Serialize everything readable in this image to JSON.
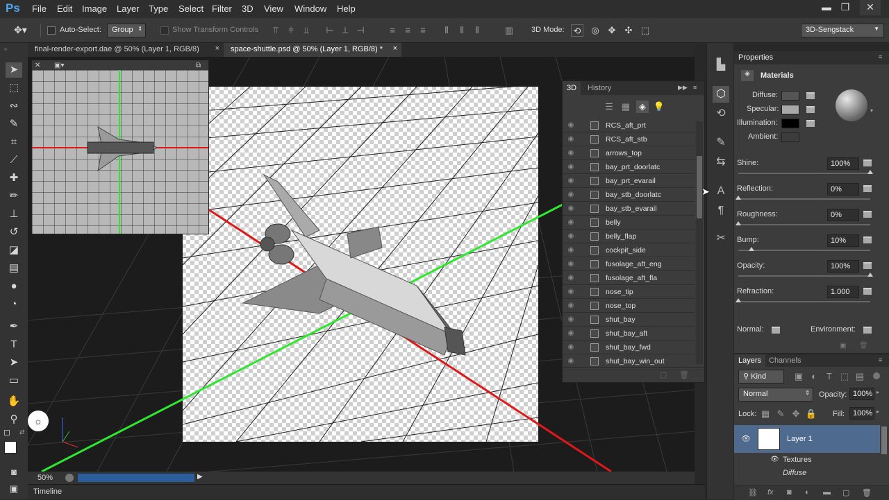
{
  "app": {
    "logo": "Ps"
  },
  "menu": [
    "File",
    "Edit",
    "Image",
    "Layer",
    "Type",
    "Select",
    "Filter",
    "3D",
    "View",
    "Window",
    "Help"
  ],
  "window_controls": {
    "minimize": "▬",
    "restore": "❐",
    "close": "✕"
  },
  "options": {
    "auto_select_label": "Auto-Select:",
    "auto_select_value": "Group",
    "show_transform_label": "Show Transform Controls",
    "mode_label": "3D Mode:",
    "workspace": "3D-Sengstack"
  },
  "doc_tabs": [
    {
      "title": "final-render-export.dae @ 50% (Layer 1, RGB/8)",
      "close": "×"
    },
    {
      "title": "space-shuttle.psd @ 50% (Layer 1, RGB/8) *",
      "close": "×"
    }
  ],
  "status": {
    "zoom": "50%"
  },
  "timeline": {
    "label": "Timeline"
  },
  "panel3d": {
    "tab_3d": "3D",
    "tab_history": "History",
    "items": [
      "RCS_aft_prt",
      "RCS_aft_stb",
      "arrows_top",
      "bay_prt_doorlatc",
      "bay_prt_evarail",
      "bay_stb_doorlatc",
      "bay_stb_evarail",
      "belly",
      "belly_flap",
      "cockpit_side",
      "fusolage_aft_eng",
      "fusolage_aft_fla",
      "nose_tip",
      "nose_top",
      "shut_bay",
      "shut_bay_aft",
      "shut_bay_fwd",
      "shut_bay_win_out"
    ]
  },
  "properties": {
    "title": "Properties",
    "section": "Materials",
    "diffuse_label": "Diffuse:",
    "specular_label": "Specular:",
    "illumination_label": "Illumination:",
    "ambient_label": "Ambient:",
    "colors": {
      "diffuse": "#555555",
      "specular": "#a8a8a8",
      "illumination": "#000000",
      "ambient": "#3c3c3c"
    },
    "params": [
      {
        "label": "Shine:",
        "value": "100%",
        "level": 1.0
      },
      {
        "label": "Reflection:",
        "value": "0%",
        "level": 0.0
      },
      {
        "label": "Roughness:",
        "value": "0%",
        "level": 0.0
      },
      {
        "label": "Bump:",
        "value": "10%",
        "level": 0.1
      },
      {
        "label": "Opacity:",
        "value": "100%",
        "level": 1.0
      },
      {
        "label": "Refraction:",
        "value": "1.000",
        "level": 0.0
      }
    ],
    "normal_label": "Normal:",
    "environment_label": "Environment:"
  },
  "layers": {
    "tab_layers": "Layers",
    "tab_channels": "Channels",
    "filter_kind": "Kind",
    "blend_mode": "Normal",
    "opacity_label": "Opacity:",
    "opacity_value": "100%",
    "lock_label": "Lock:",
    "fill_label": "Fill:",
    "fill_value": "100%",
    "layer_name": "Layer 1",
    "textures_label": "Textures",
    "diffuse_label": "Diffuse"
  }
}
